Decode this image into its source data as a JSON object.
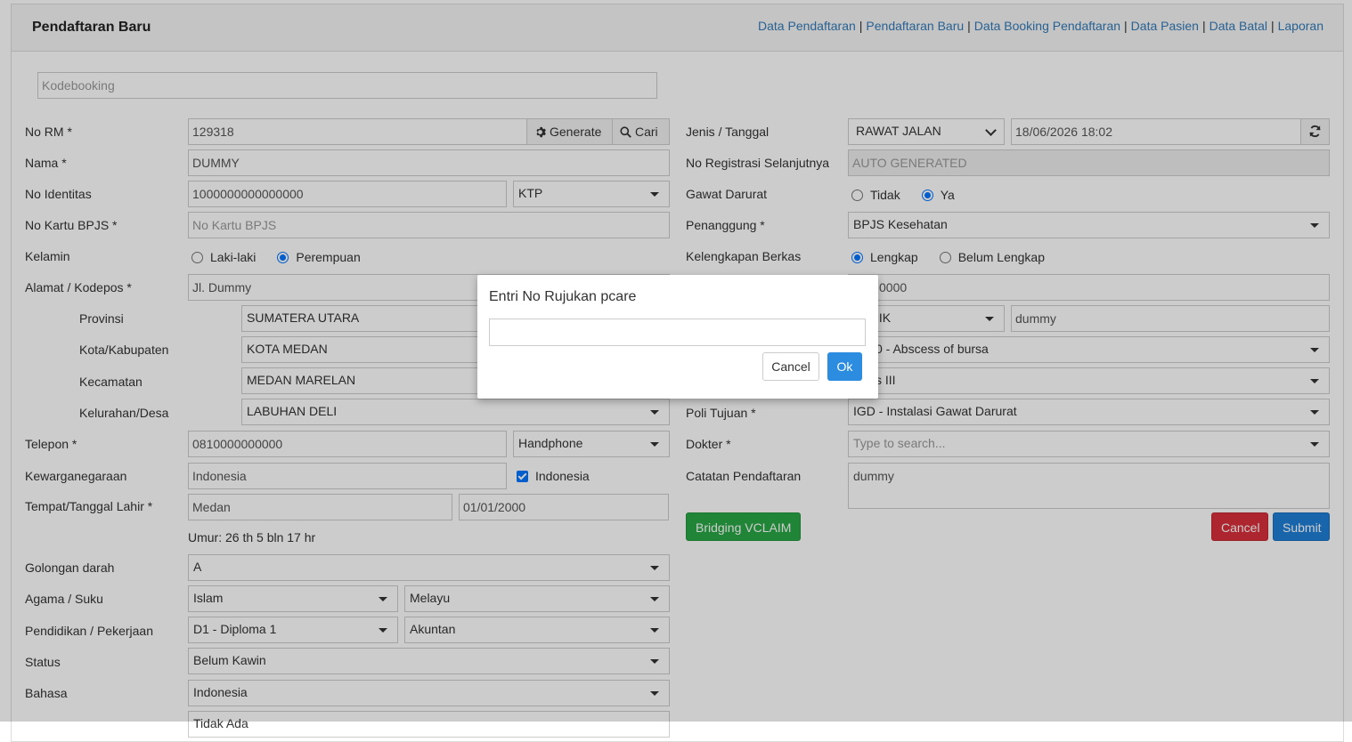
{
  "header": {
    "title": "Pendaftaran Baru",
    "nav": [
      "Data Pendaftaran",
      "Pendaftaran Baru",
      "Data Booking Pendaftaran",
      "Data Pasien",
      "Data Batal",
      "Laporan"
    ]
  },
  "kodebooking": {
    "placeholder": "Kodebooking"
  },
  "left": {
    "no_rm": {
      "label": "No RM *",
      "value": "129318",
      "generate": "Generate",
      "cari": "Cari"
    },
    "nama": {
      "label": "Nama *",
      "value": "DUMMY"
    },
    "no_identitas": {
      "label": "No Identitas",
      "value": "1000000000000000",
      "type": "KTP"
    },
    "no_kartu_bpjs": {
      "label": "No Kartu BPJS *",
      "placeholder": "No Kartu BPJS"
    },
    "kelamin": {
      "label": "Kelamin",
      "options": [
        "Laki-laki",
        "Perempuan"
      ],
      "selected": "Perempuan"
    },
    "alamat": {
      "label": "Alamat / Kodepos *",
      "value": "Jl. Dummy"
    },
    "provinsi": {
      "label": "Provinsi",
      "value": "SUMATERA UTARA"
    },
    "kota": {
      "label": "Kota/Kabupaten",
      "value": "KOTA MEDAN"
    },
    "kecamatan": {
      "label": "Kecamatan",
      "value": "MEDAN MARELAN"
    },
    "kelurahan": {
      "label": "Kelurahan/Desa",
      "value": "LABUHAN DELI"
    },
    "telepon": {
      "label": "Telepon *",
      "value": "0810000000000",
      "type": "Handphone"
    },
    "kewarganegaraan": {
      "label": "Kewarganegaraan",
      "value": "Indonesia",
      "checkbox_label": "Indonesia"
    },
    "ttl": {
      "label": "Tempat/Tanggal Lahir *",
      "tempat": "Medan",
      "tanggal": "01/01/2000"
    },
    "umur": "Umur: 26 th 5 bln 17 hr",
    "golongan_darah": {
      "label": "Golongan darah",
      "value": "A"
    },
    "agama_suku": {
      "label": "Agama / Suku",
      "agama": "Islam",
      "suku": "Melayu"
    },
    "pendidikan_pekerjaan": {
      "label": "Pendidikan / Pekerjaan",
      "pendidikan": "D1 - Diploma 1",
      "pekerjaan": "Akuntan"
    },
    "status": {
      "label": "Status",
      "value": "Belum Kawin"
    },
    "bahasa": {
      "label": "Bahasa",
      "value": "Indonesia"
    },
    "next_value": "Tidak Ada"
  },
  "right": {
    "jenis_tanggal": {
      "label": "Jenis / Tanggal",
      "jenis": "RAWAT JALAN",
      "tanggal": "18/06/2026 18:02"
    },
    "no_registrasi": {
      "label": "No Registrasi Selanjutnya",
      "placeholder": "AUTO GENERATED"
    },
    "gawat_darurat": {
      "label": "Gawat Darurat",
      "options": [
        "Tidak",
        "Ya"
      ],
      "selected": "Ya"
    },
    "penanggung": {
      "label": "Penanggung *",
      "value": "BPJS Kesehatan"
    },
    "kelengkapan": {
      "label": "Kelengkapan Berkas",
      "options": [
        "Lengkap",
        "Belum Lengkap"
      ],
      "selected": "Lengkap"
    },
    "row_hidden1": {
      "value": "0000"
    },
    "row_hidden2": {
      "select": "IIK",
      "value": "dummy"
    },
    "row_hidden3": {
      "value": "0 - Abscess of bursa"
    },
    "row_hidden4": {
      "value": "s III"
    },
    "poli_tujuan": {
      "label": "Poli Tujuan *",
      "value": "IGD - Instalasi Gawat Darurat"
    },
    "dokter": {
      "label": "Dokter *",
      "placeholder": "Type to search..."
    },
    "catatan": {
      "label": "Catatan Pendaftaran",
      "value": "dummy"
    },
    "bridging": "Bridging VCLAIM",
    "cancel": "Cancel",
    "submit": "Submit"
  },
  "modal": {
    "title": "Entri No Rujukan pcare",
    "input_value": "",
    "cancel": "Cancel",
    "ok": "Ok"
  },
  "colors": {
    "link": "#337ab7",
    "success": "#28a745",
    "danger": "#d9303b",
    "primary": "#1f7fd6",
    "radio_checked": "#0075ff"
  }
}
